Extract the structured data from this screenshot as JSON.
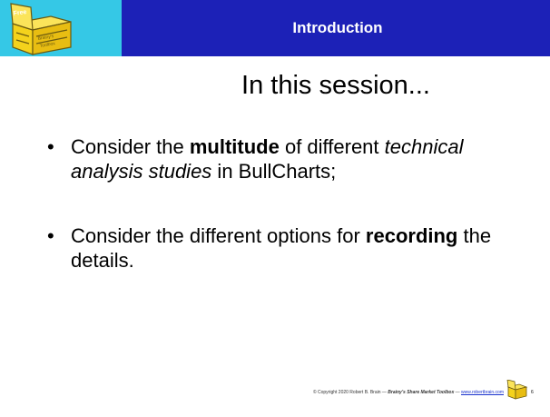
{
  "header": {
    "logo_text": "Free Brainy's Toolbox",
    "title": "Introduction"
  },
  "slide": {
    "title": "In this session...",
    "bullets": [
      {
        "parts": [
          {
            "text": "Consider the ",
            "style": "normal"
          },
          {
            "text": "multitude",
            "style": "bold"
          },
          {
            "text": " of different ",
            "style": "normal"
          },
          {
            "text": "technical analysis studies",
            "style": "italic"
          },
          {
            "text": " in BullCharts;",
            "style": "normal"
          }
        ]
      },
      {
        "parts": [
          {
            "text": "Consider the different options for ",
            "style": "normal"
          },
          {
            "text": "recording",
            "style": "bold"
          },
          {
            "text": " the details.",
            "style": "normal"
          }
        ]
      }
    ]
  },
  "footer": {
    "copyright": "© Copyright 2020 Robert B. Brain — ",
    "series": "Brainy's Share Market Toolbox",
    "dash": " — ",
    "link": "www.robertbrain.com",
    "page_number": "6"
  },
  "colors": {
    "header_logo_bg": "#35c8e6",
    "header_bar_bg": "#1c21b7",
    "box_yellow": "#f4d21c"
  }
}
